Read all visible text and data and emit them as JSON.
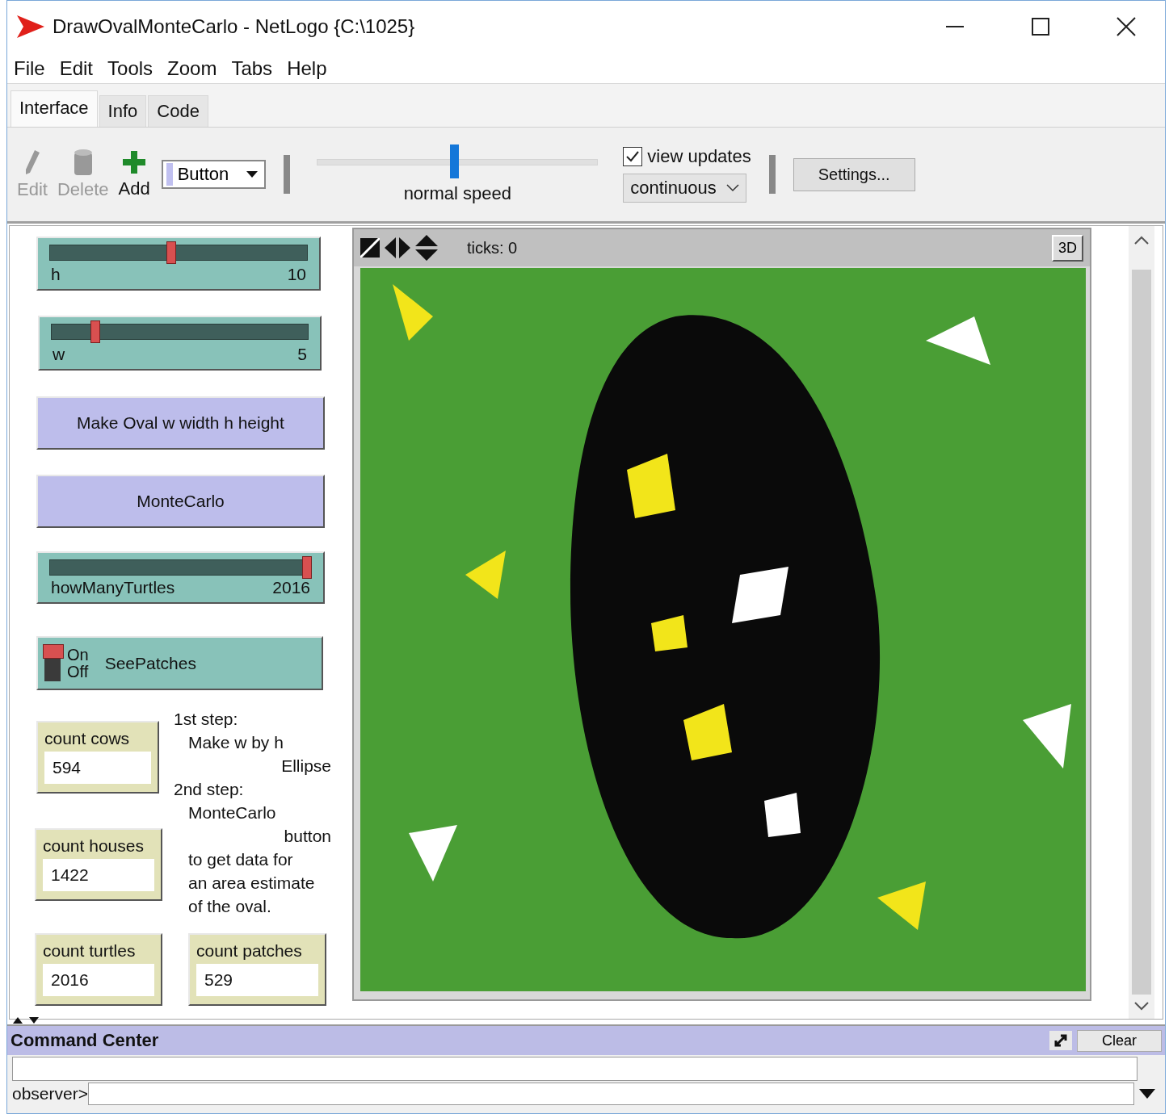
{
  "window": {
    "title": "DrawOvalMonteCarlo - NetLogo {C:\\1025}"
  },
  "menu": [
    "File",
    "Edit",
    "Tools",
    "Zoom",
    "Tabs",
    "Help"
  ],
  "tabs": [
    {
      "label": "Interface",
      "selected": true
    },
    {
      "label": "Info",
      "selected": false
    },
    {
      "label": "Code",
      "selected": false
    }
  ],
  "toolbar": {
    "tools": [
      {
        "kind": "edit",
        "label": "Edit",
        "disabled": true
      },
      {
        "kind": "delete",
        "label": "Delete",
        "disabled": true
      },
      {
        "kind": "add",
        "label": "Add",
        "disabled": false
      }
    ],
    "widget_chooser": "Button",
    "speed": {
      "level": 0.49,
      "label": "normal speed"
    },
    "view_updates": {
      "label": "view updates",
      "checked": true
    },
    "update_mode": "continuous",
    "settings": "Settings..."
  },
  "widgets": [
    {
      "kind": "slider",
      "label": "h",
      "value": "10",
      "level": 0.47
    },
    {
      "kind": "slider",
      "label": "w",
      "value": "5",
      "level": 0.16
    },
    {
      "kind": "button",
      "label": "Make Oval w width h height"
    },
    {
      "kind": "button",
      "label": "MonteCarlo"
    },
    {
      "kind": "slider",
      "label": "howManyTurtles",
      "value": "2016",
      "level": 1
    },
    {
      "kind": "switch",
      "label": "SeePatches",
      "on_label": "On",
      "off_label": "Off",
      "on": true
    },
    {
      "kind": "monitor",
      "label": "count cows",
      "value": "594"
    },
    {
      "kind": "monitor",
      "label": "count houses",
      "value": "1422"
    },
    {
      "kind": "monitor",
      "label": "count turtles",
      "value": "2016"
    },
    {
      "kind": "note",
      "lines": [
        {
          "text": "1st step:",
          "kind": "heading"
        },
        {
          "text": "Make w by h",
          "kind": "indented"
        },
        {
          "text": "Ellipse",
          "kind": "flush"
        },
        {
          "text": "2nd step:",
          "kind": "heading"
        },
        {
          "text": "MonteCarlo",
          "kind": "indented"
        },
        {
          "text": "button",
          "kind": "flush"
        },
        {
          "text": "to get data for",
          "kind": "indented"
        },
        {
          "text": "an area estimate",
          "kind": "indented"
        },
        {
          "text": "of the oval.",
          "kind": "indented"
        }
      ]
    },
    {
      "kind": "monitor",
      "label": "count patches",
      "value": "529"
    }
  ],
  "view": {
    "ticks": "ticks: 0",
    "three_d": "3D"
  },
  "command_center": {
    "title": "Command Center",
    "clear": "Clear",
    "prompt": "observer>"
  }
}
